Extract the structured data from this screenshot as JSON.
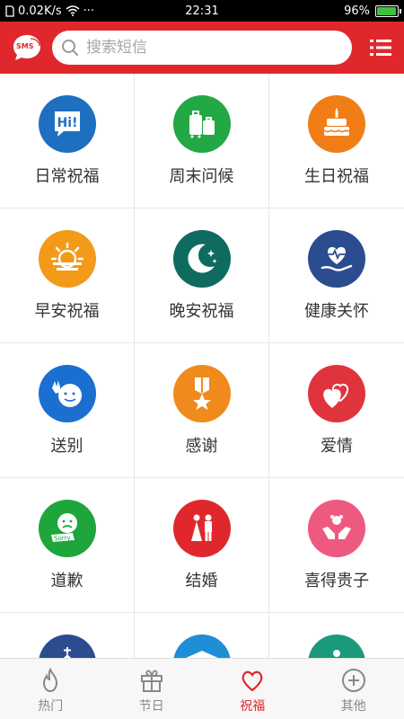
{
  "status_bar": {
    "speed": "0.02K/s",
    "dots": "···",
    "time": "22:31",
    "battery": "96%",
    "battery_level": 0.96
  },
  "header": {
    "logo_text": "SMS",
    "search_placeholder": "搜索短信"
  },
  "categories": [
    {
      "label": "日常祝福",
      "icon": "hi-bubble-icon",
      "color": "#1f6fc1"
    },
    {
      "label": "周末问候",
      "icon": "luggage-icon",
      "color": "#22a845"
    },
    {
      "label": "生日祝福",
      "icon": "cake-icon",
      "color": "#f07d16"
    },
    {
      "label": "早安祝福",
      "icon": "sunrise-icon",
      "color": "#f39a19"
    },
    {
      "label": "晚安祝福",
      "icon": "moon-stars-icon",
      "color": "#0e6b5f"
    },
    {
      "label": "健康关怀",
      "icon": "heart-pulse-hand-icon",
      "color": "#2b4d8f"
    },
    {
      "label": "送别",
      "icon": "waving-face-icon",
      "color": "#1a6fd0"
    },
    {
      "label": "感谢",
      "icon": "medal-icon",
      "color": "#f08a1d"
    },
    {
      "label": "爱情",
      "icon": "hearts-icon",
      "color": "#e0343c"
    },
    {
      "label": "道歉",
      "icon": "sorry-face-icon",
      "color": "#1ea53c",
      "extra_text": "Sorry"
    },
    {
      "label": "结婚",
      "icon": "wedding-couple-icon",
      "color": "#e0282c"
    },
    {
      "label": "喜得贵子",
      "icon": "baby-hands-icon",
      "color": "#ee5a7f"
    },
    {
      "label": "",
      "icon": "church-icon",
      "color": "#2b4d8f"
    },
    {
      "label": "",
      "icon": "graduation-cap-icon",
      "color": "#1e8fd6"
    },
    {
      "label": "",
      "icon": "person-teal-icon",
      "color": "#1a9a7a"
    }
  ],
  "tabs": [
    {
      "label": "热门",
      "icon": "flame-icon",
      "active": false
    },
    {
      "label": "节日",
      "icon": "gift-icon",
      "active": false
    },
    {
      "label": "祝福",
      "icon": "heart-icon",
      "active": true
    },
    {
      "label": "其他",
      "icon": "plus-circle-icon",
      "active": false
    }
  ],
  "colors": {
    "brand_red": "#e0282c",
    "tab_inactive": "#888888"
  }
}
